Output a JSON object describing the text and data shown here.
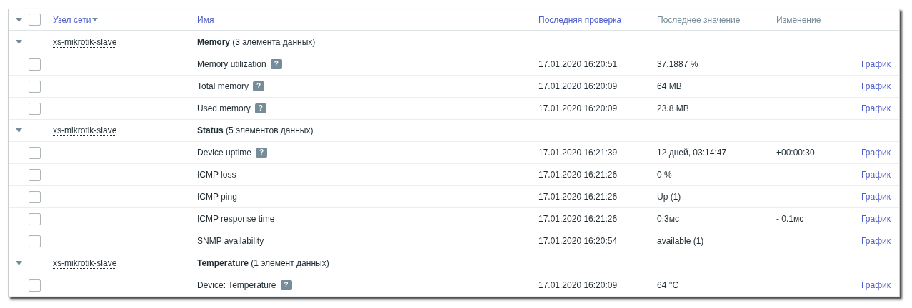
{
  "header": {
    "expanded": true,
    "checked": false,
    "columns": [
      {
        "label": "Узел сети",
        "sortable": true,
        "sorted_descending": true
      },
      {
        "label": "Имя",
        "sortable": true
      },
      {
        "label": "Последняя проверка",
        "sortable": true
      },
      {
        "label": "Последнее значение",
        "sortable": false
      },
      {
        "label": "Изменение",
        "sortable": false
      }
    ]
  },
  "groups": [
    {
      "host": "xs-mikrotik-slave",
      "name": "Memory",
      "count": "(3 элемента данных)",
      "expanded": true,
      "items": [
        {
          "name": "Memory utilization",
          "hint": "?",
          "checked": false,
          "last_check": "17.01.2020 16:20:51",
          "last_value": "37.1887 %",
          "graph": "График"
        },
        {
          "name": "Total memory",
          "hint": "?",
          "checked": false,
          "last_check": "17.01.2020 16:20:09",
          "last_value": "64 MB",
          "graph": "График"
        },
        {
          "name": "Used memory",
          "hint": "?",
          "checked": false,
          "last_check": "17.01.2020 16:20:09",
          "last_value": "23.8 MB",
          "graph": "График"
        }
      ]
    },
    {
      "host": "xs-mikrotik-slave",
      "name": "Status",
      "count": "(5 элементов данных)",
      "expanded": true,
      "items": [
        {
          "name": "Device uptime",
          "hint": "?",
          "checked": false,
          "last_check": "17.01.2020 16:21:39",
          "last_value": "12 дней, 03:14:47",
          "change": "+00:00:30",
          "graph": "График"
        },
        {
          "name": "ICMP loss",
          "checked": false,
          "last_check": "17.01.2020 16:21:26",
          "last_value": "0 %",
          "graph": "График"
        },
        {
          "name": "ICMP ping",
          "checked": false,
          "last_check": "17.01.2020 16:21:26",
          "last_value": "Up (1)",
          "graph": "График"
        },
        {
          "name": "ICMP response time",
          "checked": false,
          "last_check": "17.01.2020 16:21:26",
          "last_value": "0.3мс",
          "change": "- 0.1мс",
          "graph": "График"
        },
        {
          "name": "SNMP availability",
          "checked": false,
          "last_check": "17.01.2020 16:20:54",
          "last_value": "available (1)",
          "graph": "График"
        }
      ]
    },
    {
      "host": "xs-mikrotik-slave",
      "name": "Temperature",
      "count": "(1 элемент данных)",
      "expanded": true,
      "items": [
        {
          "name": "Device: Temperature",
          "hint": "?",
          "checked": false,
          "last_check": "17.01.2020 16:20:09",
          "last_value": "64 °C",
          "graph": "График"
        }
      ]
    }
  ]
}
